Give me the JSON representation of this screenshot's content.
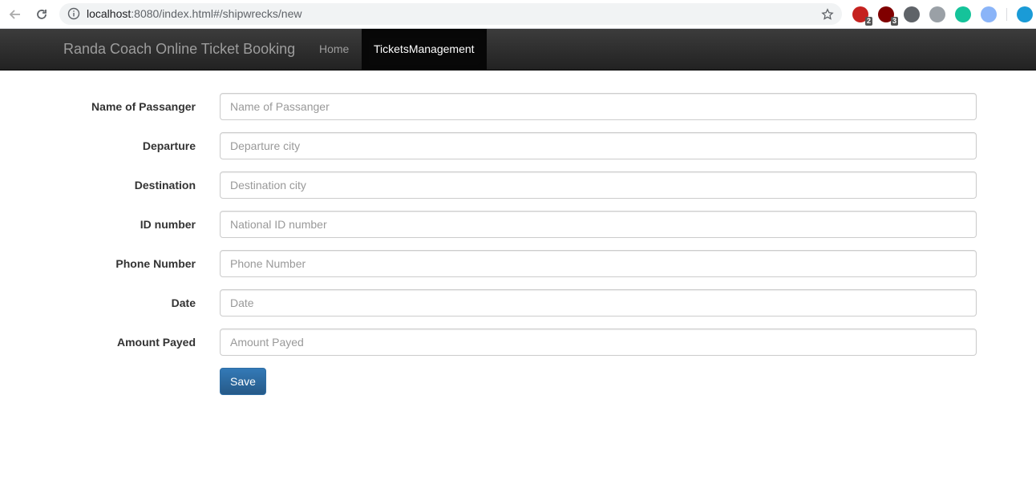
{
  "browser": {
    "url_host": "localhost",
    "url_path": ":8080/index.html#/shipwrecks/new",
    "icons": [
      "back-arrow-icon",
      "reload-icon",
      "info-icon",
      "star-icon"
    ],
    "extensions": [
      {
        "name": "ext-red-icon",
        "color": "#c5221f",
        "badge": "2"
      },
      {
        "name": "ublock-icon",
        "color": "#800000",
        "badge": "3"
      },
      {
        "name": "shield-icon",
        "color": "#5f6368",
        "badge": ""
      },
      {
        "name": "globe-icon",
        "color": "#9aa0a6",
        "badge": ""
      },
      {
        "name": "grammarly-icon",
        "color": "#15c39a",
        "badge": ""
      },
      {
        "name": "ext-blue-icon",
        "color": "#8ab4f8",
        "badge": ""
      },
      {
        "name": "profile-icon",
        "color": "#1a9bd7",
        "badge": ""
      }
    ]
  },
  "navbar": {
    "brand": "Randa Coach Online Ticket Booking",
    "items": [
      {
        "label": "Home",
        "active": false
      },
      {
        "label": "TicketsManagement",
        "active": true
      }
    ]
  },
  "form": {
    "fields": [
      {
        "label": "Name of Passanger",
        "placeholder": "Name of Passanger",
        "value": ""
      },
      {
        "label": "Departure",
        "placeholder": "Departure city",
        "value": ""
      },
      {
        "label": "Destination",
        "placeholder": "Destination city",
        "value": ""
      },
      {
        "label": "ID number",
        "placeholder": "National ID number",
        "value": ""
      },
      {
        "label": "Phone Number",
        "placeholder": "Phone Number",
        "value": ""
      },
      {
        "label": "Date",
        "placeholder": "Date",
        "value": ""
      },
      {
        "label": "Amount Payed",
        "placeholder": "Amount Payed",
        "value": ""
      }
    ],
    "save_label": "Save"
  },
  "colors": {
    "navbar_bg": "#222222",
    "navbar_active": "#080808",
    "primary_button": "#337ab7"
  }
}
